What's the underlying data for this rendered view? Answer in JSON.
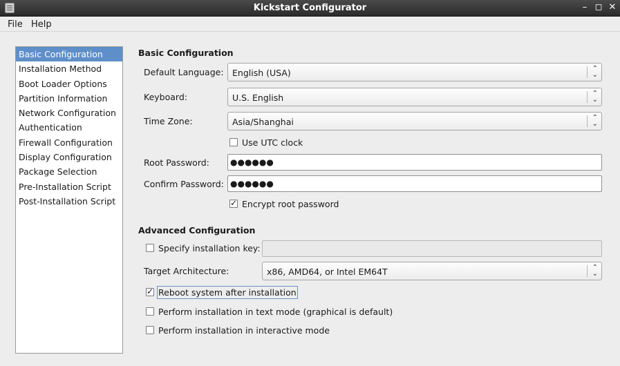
{
  "window": {
    "title": "Kickstart Configurator",
    "controls": {
      "minimize": "–",
      "maximize": "◻",
      "close": "✕"
    }
  },
  "menubar": {
    "file": "File",
    "help": "Help"
  },
  "sidebar": {
    "items": [
      {
        "label": "Basic Configuration",
        "selected": true
      },
      {
        "label": "Installation Method"
      },
      {
        "label": "Boot Loader Options"
      },
      {
        "label": "Partition Information"
      },
      {
        "label": "Network Configuration"
      },
      {
        "label": "Authentication"
      },
      {
        "label": "Firewall Configuration"
      },
      {
        "label": "Display Configuration"
      },
      {
        "label": "Package Selection"
      },
      {
        "label": "Pre-Installation Script"
      },
      {
        "label": "Post-Installation Script"
      }
    ]
  },
  "basic": {
    "title": "Basic Configuration",
    "language_label": "Default Language:",
    "language_value": "English (USA)",
    "keyboard_label": "Keyboard:",
    "keyboard_value": "U.S. English",
    "timezone_label": "Time Zone:",
    "timezone_value": "Asia/Shanghai",
    "utc_label": "Use UTC clock",
    "utc_checked": false,
    "root_password_label": "Root Password:",
    "root_password_value": "●●●●●●",
    "confirm_password_label": "Confirm Password:",
    "confirm_password_value": "●●●●●●",
    "encrypt_label": "Encrypt root password",
    "encrypt_checked": true
  },
  "advanced": {
    "title": "Advanced Configuration",
    "install_key_label": "Specify installation key:",
    "install_key_checked": false,
    "install_key_value": "",
    "arch_label": "Target Architecture:",
    "arch_value": "x86, AMD64, or Intel EM64T",
    "reboot_label": "Reboot system after installation",
    "reboot_checked": true,
    "textmode_label": "Perform installation in text mode (graphical is default)",
    "textmode_checked": false,
    "interactive_label": "Perform installation in interactive mode",
    "interactive_checked": false
  },
  "glyphs": {
    "check": "✓",
    "combo_arrow_up": "⌃",
    "combo_arrow_down": "⌄"
  }
}
